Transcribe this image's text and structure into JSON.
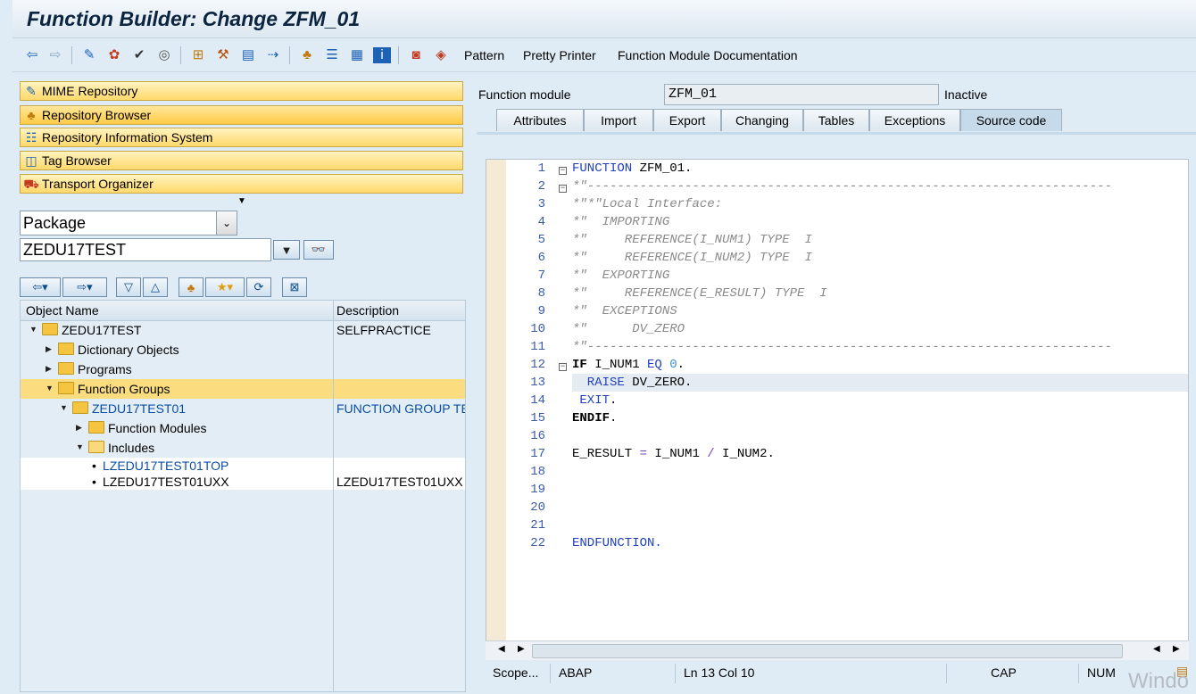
{
  "window": {
    "title": "Function Builder: Change ZFM_01"
  },
  "toolbar": {
    "icons": [
      "back-arrow-icon",
      "forward-arrow-icon",
      "display-change-icon",
      "activate-icon",
      "check-icon",
      "where-used-icon",
      "object-list-icon",
      "edit-wand-icon",
      "test-icon",
      "navigate-icon",
      "hierarchy-icon",
      "stack-icon",
      "layout-icon",
      "info-icon",
      "db-icon",
      "debug-icon"
    ],
    "pattern": "Pattern",
    "pretty_printer": "Pretty Printer",
    "fm_documentation": "Function Module Documentation"
  },
  "navigator": {
    "buttons": [
      "MIME Repository",
      "Repository Browser",
      "Repository Information System",
      "Tag Browser",
      "Transport Organizer"
    ],
    "object_type": "Package",
    "object_name": "ZEDU17TEST"
  },
  "tree": {
    "columns": {
      "name": "Object Name",
      "description": "Description"
    },
    "rows": [
      {
        "name": "ZEDU17TEST",
        "description": "SELFPRACTICE"
      },
      {
        "name": "Dictionary Objects",
        "description": ""
      },
      {
        "name": "Programs",
        "description": ""
      },
      {
        "name": "Function Groups",
        "description": ""
      },
      {
        "name": "ZEDU17TEST01",
        "description": "FUNCTION GROUP TE"
      },
      {
        "name": "Function Modules",
        "description": ""
      },
      {
        "name": "Includes",
        "description": ""
      },
      {
        "name": "LZEDU17TEST01TOP",
        "description": ""
      },
      {
        "name": "LZEDU17TEST01UXX",
        "description": "LZEDU17TEST01UXX"
      }
    ]
  },
  "header": {
    "fm_label": "Function module",
    "fm_value": "ZFM_01",
    "status": "Inactive"
  },
  "tabs": [
    "Attributes",
    "Import",
    "Export",
    "Changing",
    "Tables",
    "Exceptions",
    "Source code"
  ],
  "active_tab": "Source code",
  "code": {
    "l1": [
      "FUNCTION",
      " ZFM_01."
    ],
    "l2": "*\"----------------------------------------------------------------------",
    "l3": "*\"*\"Local Interface:",
    "l4": "*\"  IMPORTING",
    "l5": "*\"     REFERENCE(I_NUM1) TYPE  I",
    "l6": "*\"     REFERENCE(I_NUM2) TYPE  I",
    "l7": "*\"  EXPORTING",
    "l8": "*\"     REFERENCE(E_RESULT) TYPE  I",
    "l9": "*\"  EXCEPTIONS",
    "l10": "*\"      DV_ZERO",
    "l11": "*\"----------------------------------------------------------------------",
    "l12": [
      "IF",
      " I_NUM1 ",
      "EQ",
      " ",
      "0",
      "."
    ],
    "l13": [
      "  RAISE",
      " DV_ZERO."
    ],
    "l14": [
      " EXIT",
      "."
    ],
    "l15": [
      "ENDIF",
      "."
    ],
    "l17": [
      "E_RESULT ",
      "=",
      " I_NUM1 ",
      "/",
      " I_NUM2."
    ],
    "l22": "ENDFUNCTION."
  },
  "line_numbers": [
    "1",
    "2",
    "3",
    "4",
    "5",
    "6",
    "7",
    "8",
    "9",
    "10",
    "11",
    "12",
    "13",
    "14",
    "15",
    "16",
    "17",
    "18",
    "19",
    "20",
    "21",
    "22"
  ],
  "statusbar": {
    "scope": "Scope...",
    "language": "ABAP",
    "position": "Ln  13 Col  10",
    "caps": "CAP",
    "num": "NUM"
  },
  "watermark": "Windo"
}
